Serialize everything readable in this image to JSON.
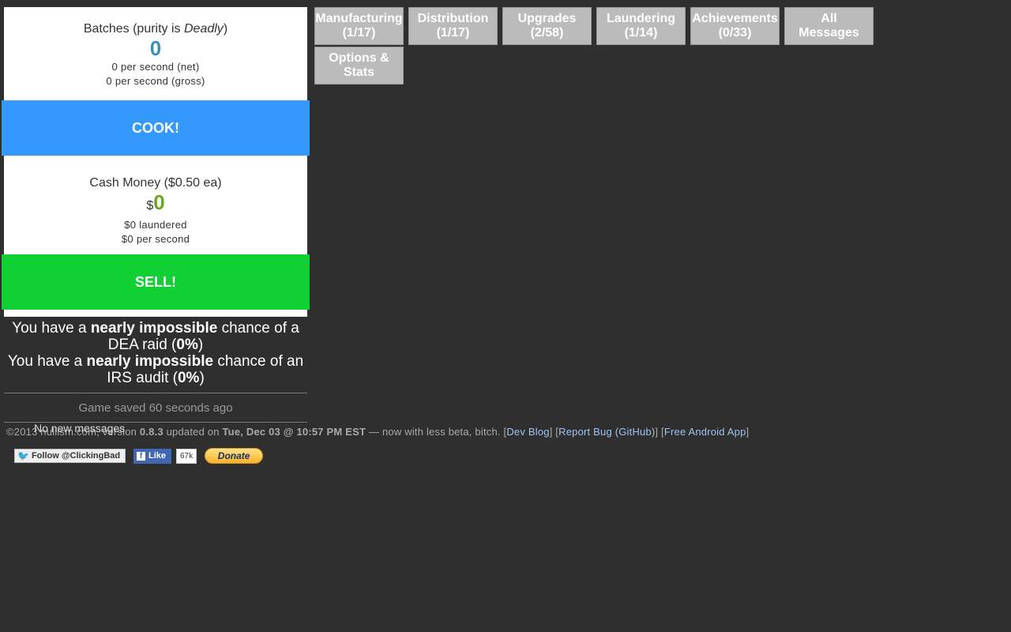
{
  "batches": {
    "label_prefix": "Batches (purity is ",
    "purity": "Deadly",
    "label_suffix": ")",
    "count": "0",
    "net_rate": "0 per second (net)",
    "gross_rate": "0 per second (gross)"
  },
  "cook_button": "COOK!",
  "cash": {
    "label": "Cash Money ($0.50 ea)",
    "currency": "$",
    "amount": "0",
    "laundered": "$0 laundered",
    "rate": "$0 per second"
  },
  "sell_button": "SELL!",
  "risk": {
    "dea_pre": "You have a ",
    "dea_level": "nearly impossible",
    "dea_mid": " chance of a DEA raid (",
    "dea_pct": "0%",
    "dea_post": ")",
    "irs_pre": "You have a ",
    "irs_level": "nearly impossible",
    "irs_mid": " chance of an IRS audit (",
    "irs_pct": "0%",
    "irs_post": ")"
  },
  "status": {
    "saved": "Game saved 60 seconds ago",
    "messages": "No new messages"
  },
  "tabs": [
    {
      "name": "Manufacturing",
      "count": "(1/17)"
    },
    {
      "name": "Distribution",
      "count": "(1/17)"
    },
    {
      "name": "Upgrades",
      "count": "(2/58)"
    },
    {
      "name": "Laundering",
      "count": "(1/14)"
    },
    {
      "name": "Achievements",
      "count": "(0/33)"
    },
    {
      "name": "All",
      "count": "Messages"
    },
    {
      "name": "Options &",
      "count": "Stats"
    }
  ],
  "footer": {
    "copyright": "©2013 nullism.com, version ",
    "version": "0.8.3",
    "updated_on": " updated on ",
    "date": "Tue, Dec 03 @ 10:57 PM EST",
    "tagline": " — now with less beta, bitch. [",
    "dev_blog": "Dev Blog",
    "sep1": "] [",
    "report_bug": "Report Bug (GitHub)",
    "sep2": "] [",
    "android": "Free Android App",
    "end": "]"
  },
  "social": {
    "twitter": "Follow @ClickingBad",
    "fb_like": "Like",
    "fb_count": "67k",
    "donate": "Donate"
  },
  "colors": {
    "background": "#2f2f2f",
    "cook": "#3399ff",
    "sell": "#11d033",
    "batches_number": "#3a8fbd",
    "cash_number": "#6aa820",
    "tab": "#bbbbbb",
    "link": "#9ec5f0"
  }
}
